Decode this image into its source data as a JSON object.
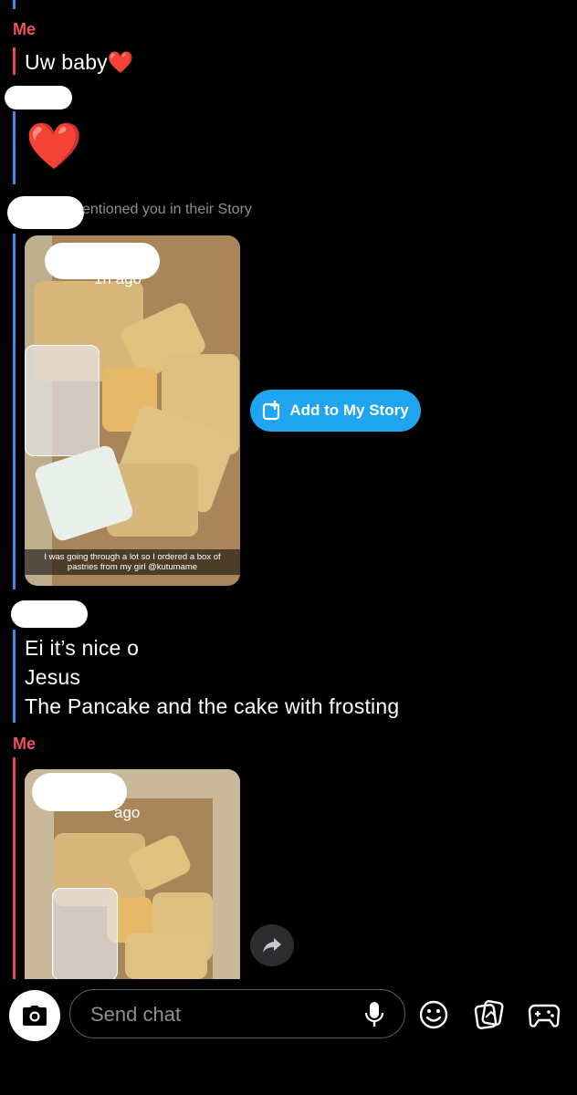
{
  "conversation": {
    "me_label_1": "Me",
    "me_message_1": "Uw baby❤️",
    "friend_heart": "❤️",
    "mention_notice": "entioned you in their Story",
    "story_1": {
      "time_ago": "1h ago",
      "caption": "I was going through a lot so I ordered a box of pastries from my girl @kutumame"
    },
    "add_to_story_label": "Add to My Story",
    "friend_messages": [
      "Ei it’s nice o",
      "Jesus",
      "The Pancake and the cake with frosting"
    ],
    "me_label_2": "Me",
    "story_2": {
      "time_ago": "ago"
    }
  },
  "composer": {
    "placeholder": "Send chat"
  },
  "colors": {
    "me_accent": "#e8454f",
    "friend_accent": "#3a8de0",
    "add_story_blue": "#1fa5f0"
  },
  "icons": [
    "camera-icon",
    "microphone-icon",
    "smiley-icon",
    "sticker-icon",
    "game-controller-icon",
    "share-arrow-icon",
    "add-story-icon"
  ]
}
